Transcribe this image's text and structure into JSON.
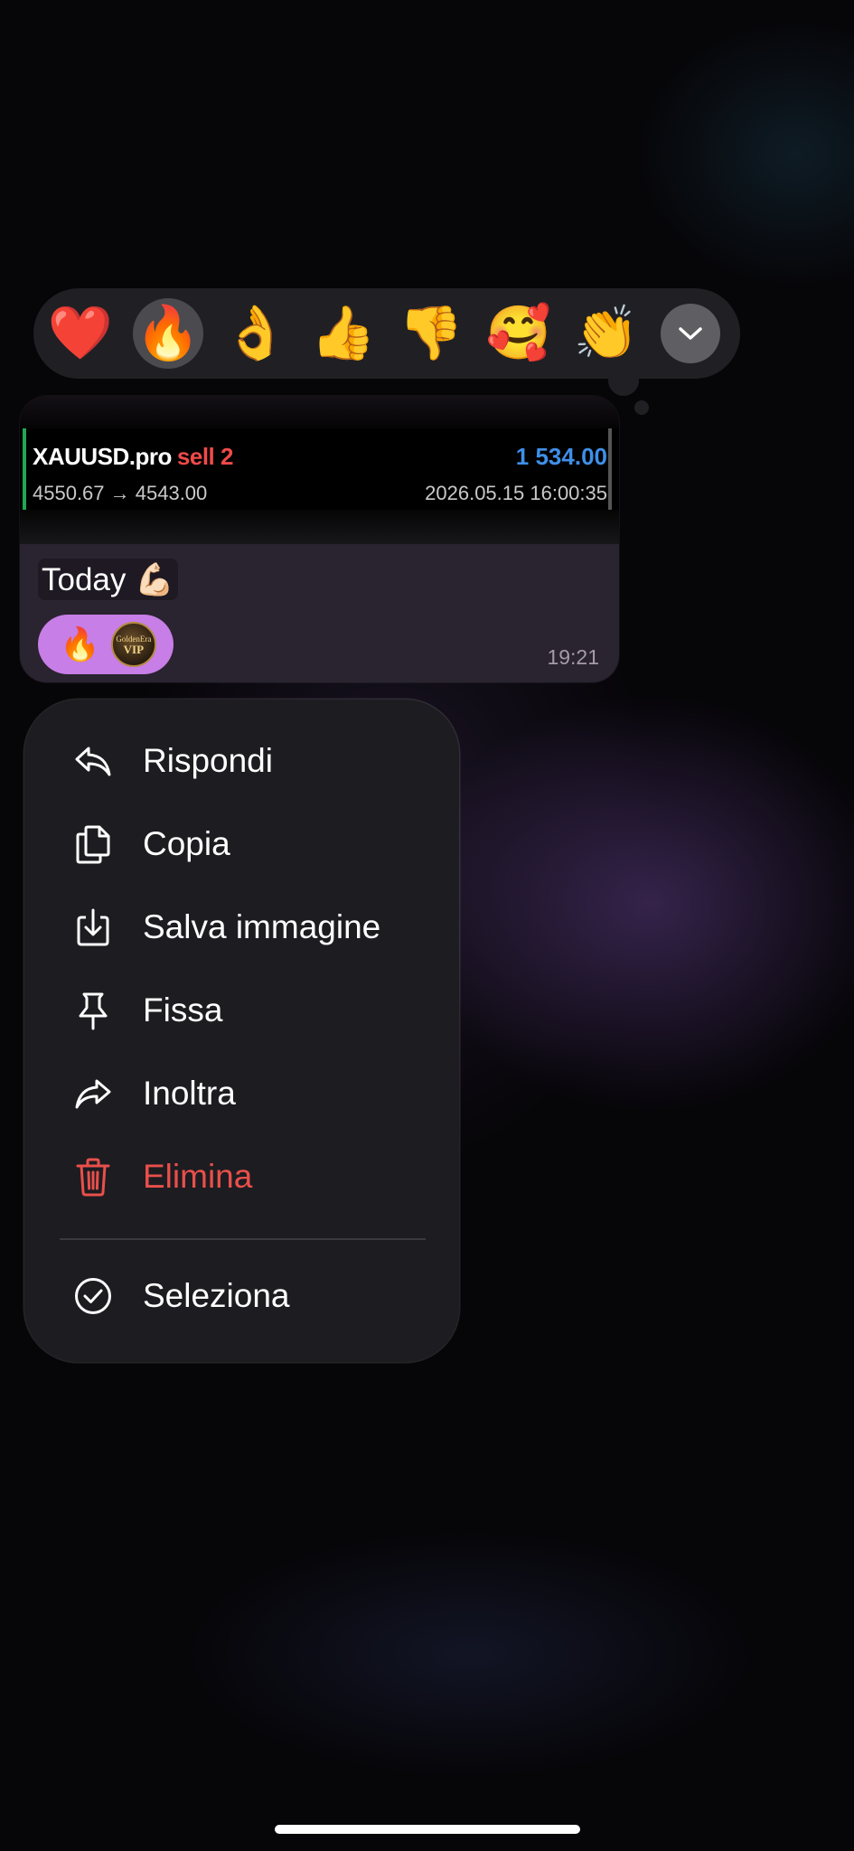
{
  "reactions": {
    "items": [
      "❤️",
      "🔥",
      "👌",
      "👍",
      "👎",
      "🥰",
      "👏"
    ],
    "selected": "🔥",
    "expand_icon": "chevron-down-icon"
  },
  "message": {
    "trade": {
      "symbol": "XAUUSD.pro",
      "side": "sell 2",
      "profit": "1 534.00",
      "prices": "4550.67 → 4543.00",
      "datetime": "2026.05.15 16:00:35"
    },
    "caption": "Today 💪🏻",
    "reaction_emoji": "🔥",
    "reactor_avatar_text": [
      "GoldenEra",
      "VIP"
    ],
    "time": "19:21"
  },
  "menu": {
    "items": [
      {
        "label": "Rispondi",
        "icon": "reply-icon"
      },
      {
        "label": "Copia",
        "icon": "copy-icon"
      },
      {
        "label": "Salva immagine",
        "icon": "save-image-icon"
      },
      {
        "label": "Fissa",
        "icon": "pin-icon"
      },
      {
        "label": "Inoltra",
        "icon": "forward-icon"
      },
      {
        "label": "Elimina",
        "icon": "trash-icon",
        "color": "#e8504b"
      }
    ],
    "select": {
      "label": "Seleziona",
      "icon": "check-circle-icon"
    }
  },
  "colors": {
    "accent_profit": "#3f8fe8",
    "sell": "#ef4a4a",
    "delete": "#e8504b",
    "reaction_pill": "#c77ee6"
  }
}
